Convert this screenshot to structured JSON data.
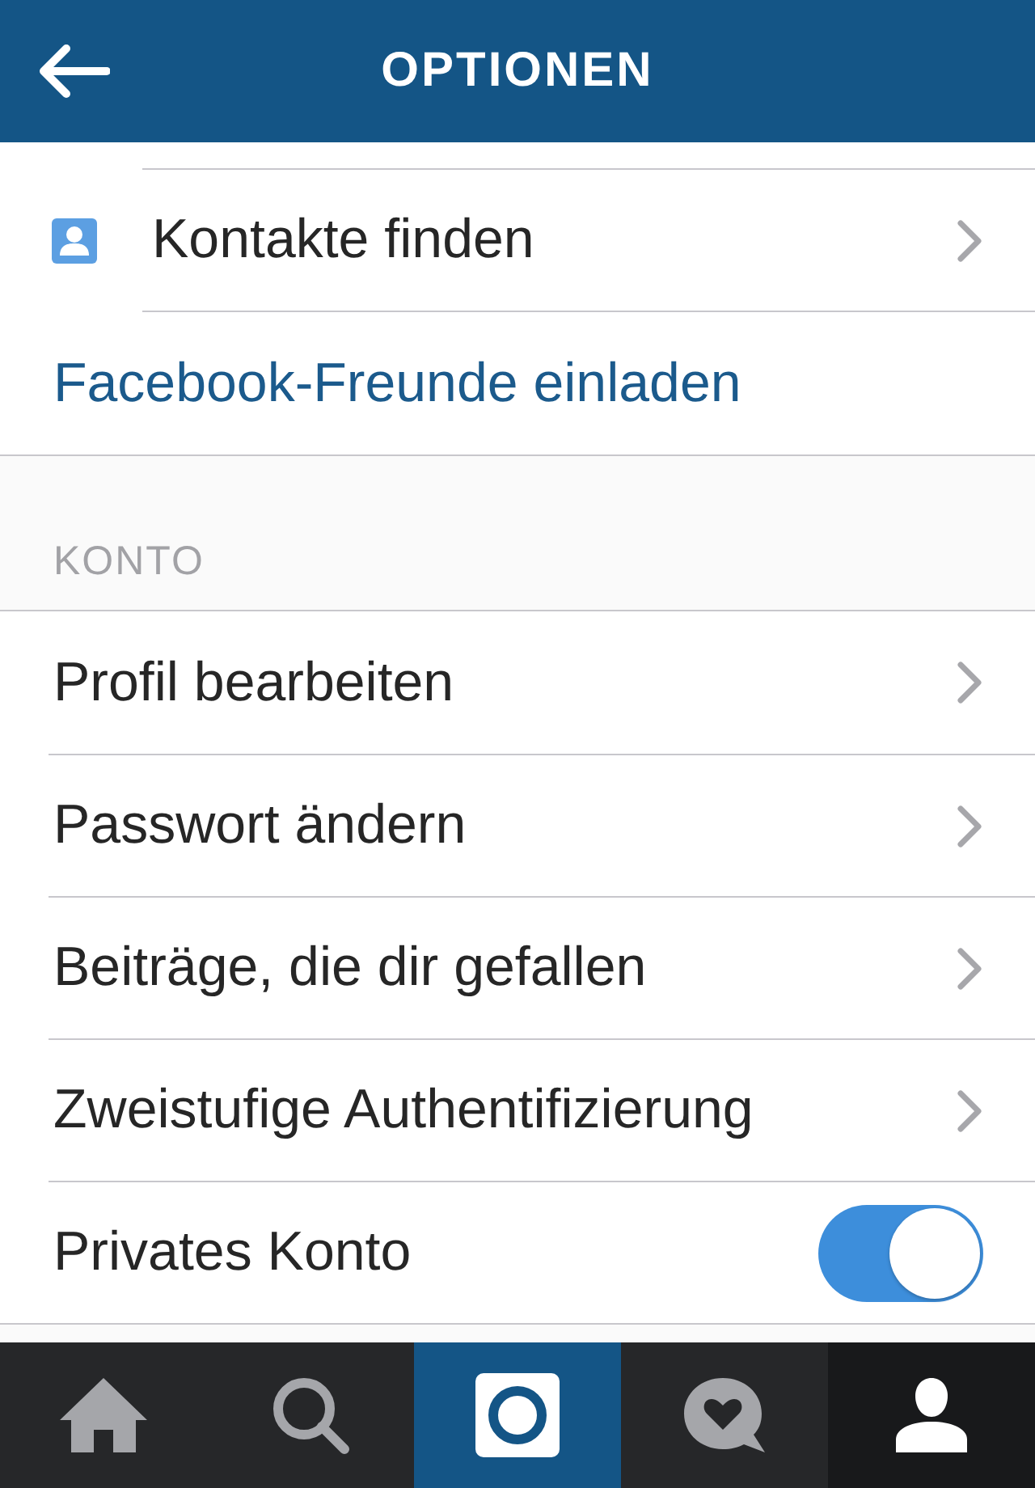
{
  "header": {
    "title": "OPTIONEN"
  },
  "top_rows": [
    {
      "kind": "contacts",
      "label": "Kontakte finden"
    },
    {
      "kind": "link",
      "label": "Facebook-Freunde einladen"
    }
  ],
  "sections": [
    {
      "title": "KONTO",
      "rows": [
        {
          "kind": "nav",
          "label": "Profil bearbeiten"
        },
        {
          "kind": "nav",
          "label": "Passwort ändern"
        },
        {
          "kind": "nav",
          "label": "Beiträge, die dir gefallen"
        },
        {
          "kind": "nav",
          "label": "Zweistufige Authentifizierung"
        },
        {
          "kind": "toggle",
          "label": "Privates Konto",
          "on": true
        }
      ]
    }
  ],
  "tab_bar": {
    "tabs": [
      {
        "kind": "home",
        "selected": false
      },
      {
        "kind": "search",
        "selected": false
      },
      {
        "kind": "camera",
        "selected": false
      },
      {
        "kind": "activity",
        "selected": false
      },
      {
        "kind": "profile",
        "selected": true
      }
    ]
  }
}
